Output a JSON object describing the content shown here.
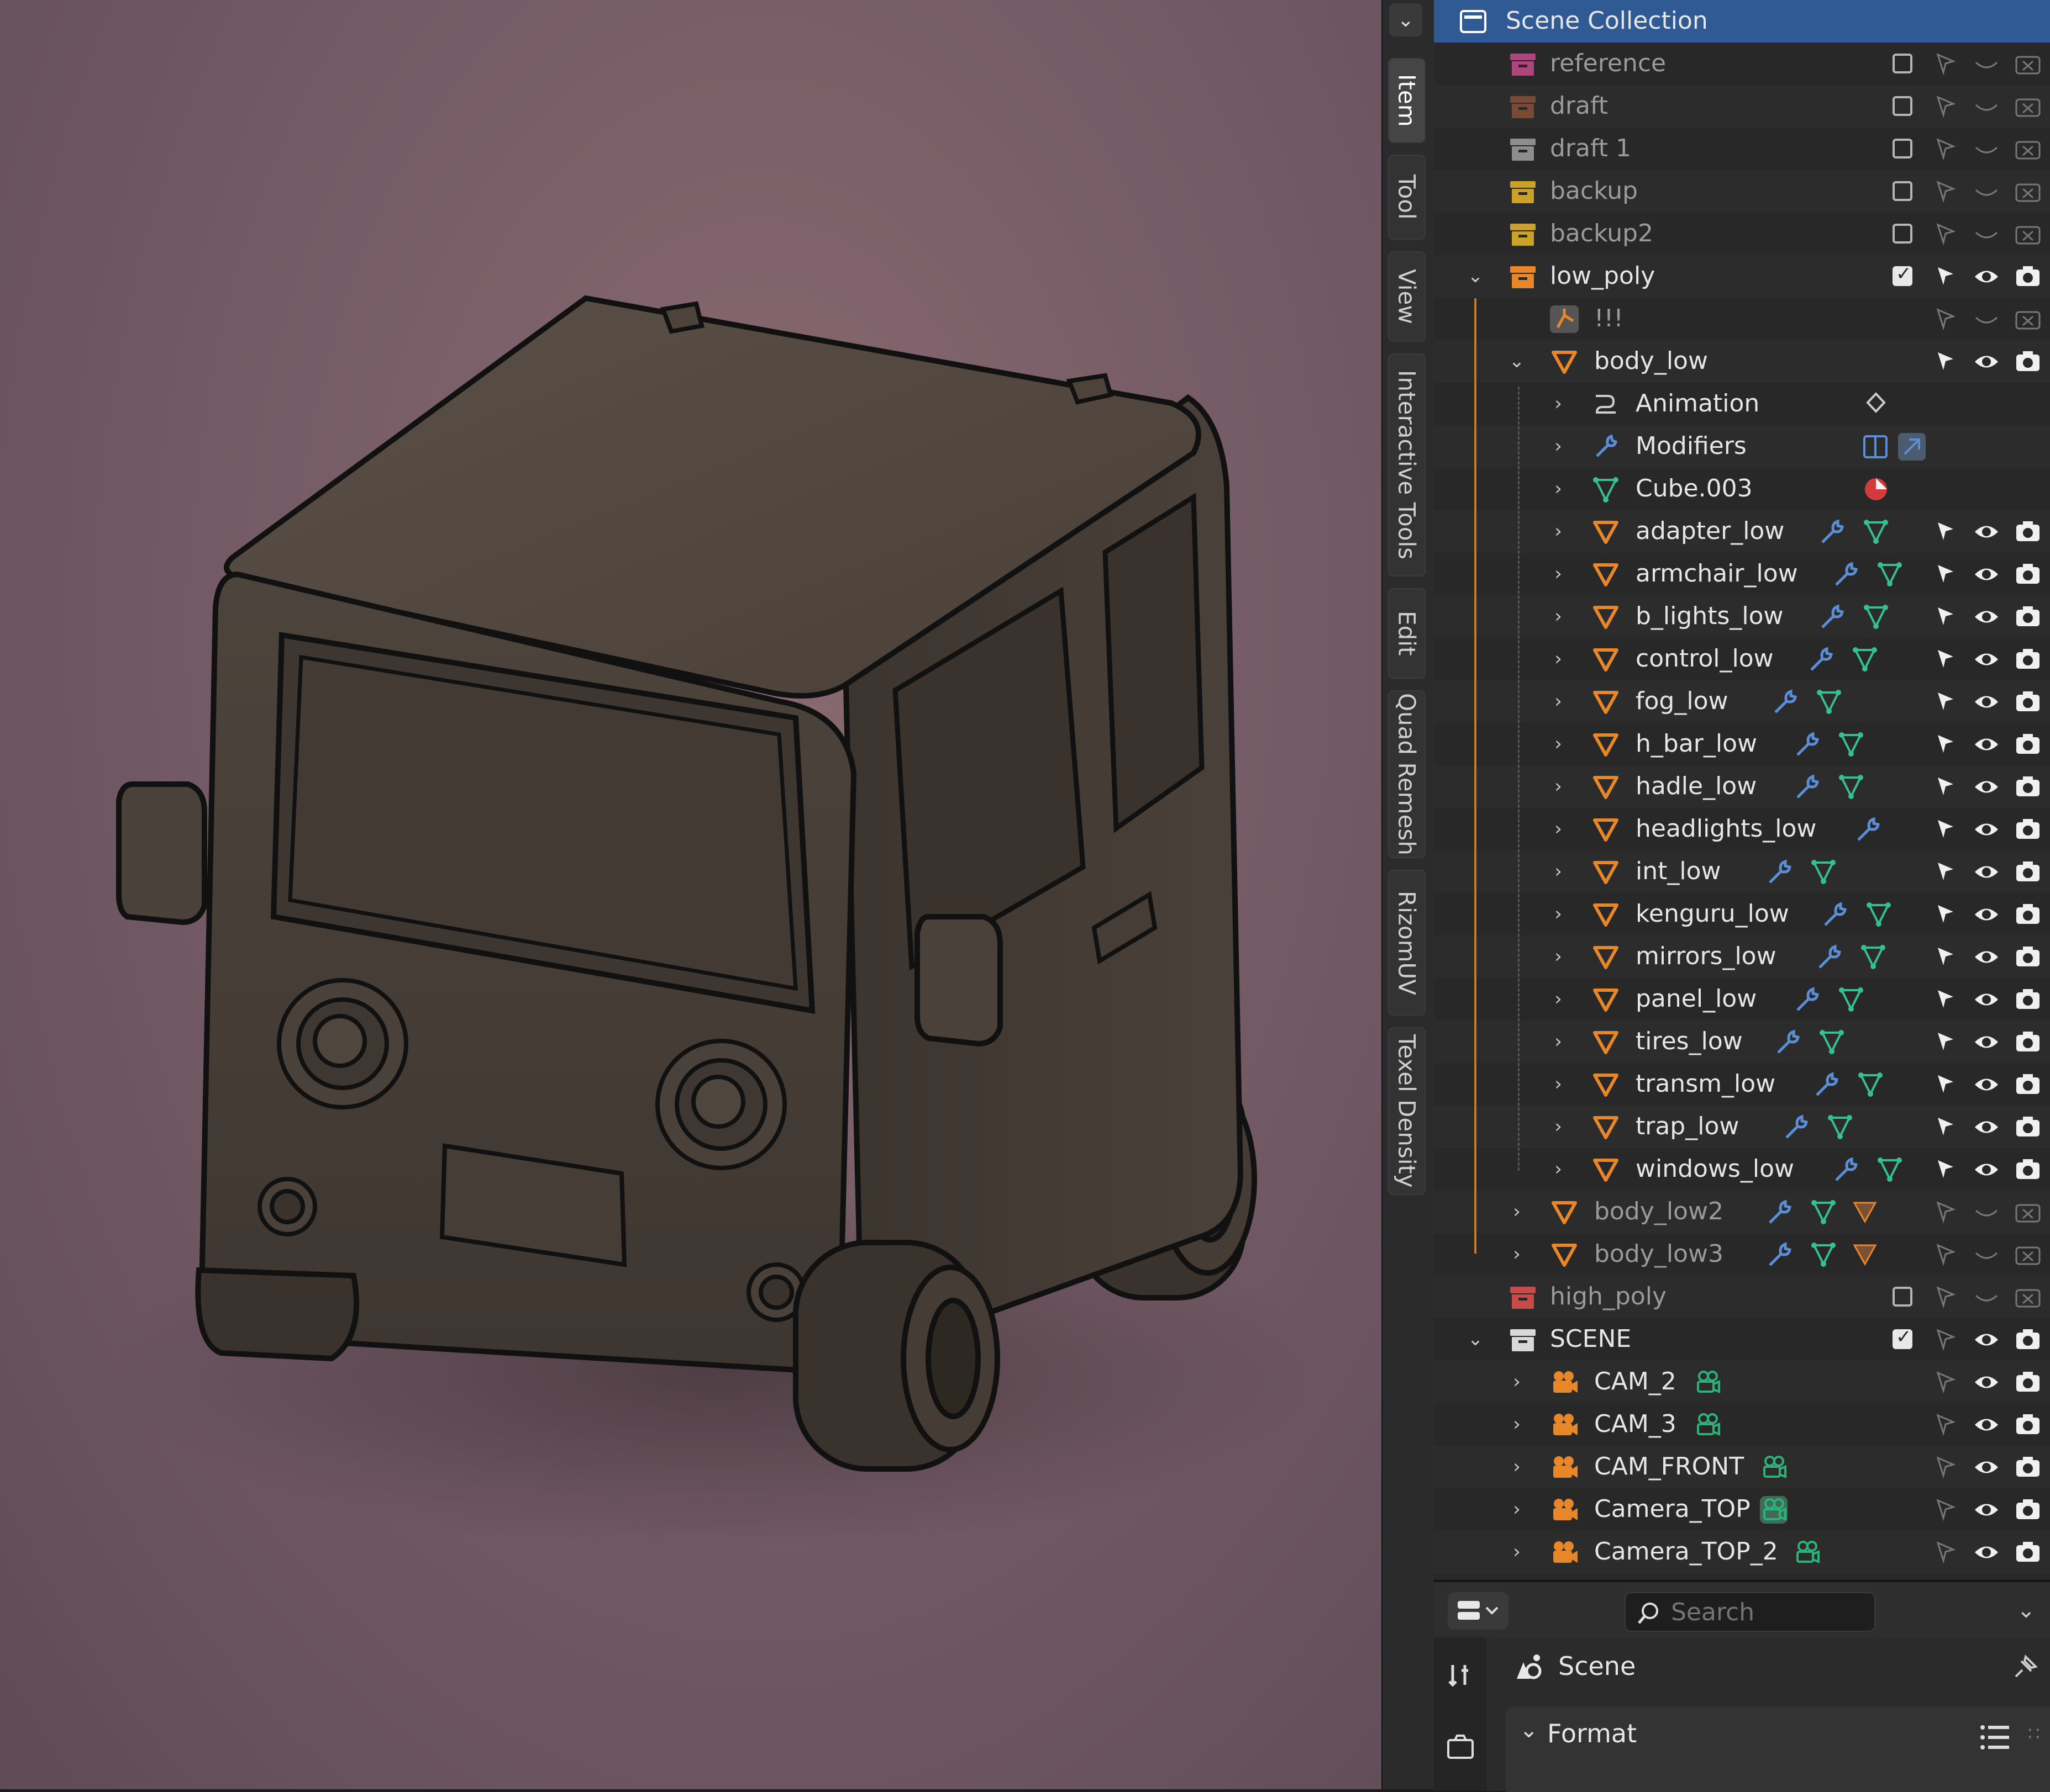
{
  "npanel": {
    "tabs": [
      "Item",
      "Tool",
      "View",
      "Interactive Tools",
      "Edit",
      "Quad Remesh",
      "RizomUV",
      "Texel Density"
    ]
  },
  "outliner": {
    "header": "Scene Collection",
    "rows": [
      {
        "label": "reference",
        "kind": "collection",
        "icon_color": "#b0457d",
        "dim": true
      },
      {
        "label": "draft",
        "kind": "collection",
        "icon_color": "#7a4a35",
        "dim": true
      },
      {
        "label": "draft 1",
        "kind": "collection",
        "icon_color": "#8d8d8d",
        "dim": true
      },
      {
        "label": "backup",
        "kind": "collection",
        "icon_color": "#c9a227",
        "dim": true
      },
      {
        "label": "backup2",
        "kind": "collection",
        "icon_color": "#c9a227",
        "dim": true
      },
      {
        "label": "low_poly",
        "kind": "collection",
        "icon_color": "#e8862a",
        "checked": true
      },
      {
        "label": "!!!",
        "kind": "empty",
        "dim": true
      },
      {
        "label": "body_low",
        "kind": "mesh"
      },
      {
        "label": "Animation",
        "kind": "animation"
      },
      {
        "label": "Modifiers",
        "kind": "modifiers"
      },
      {
        "label": "Cube.003",
        "kind": "meshdata"
      },
      {
        "label": "adapter_low",
        "kind": "mesh"
      },
      {
        "label": "armchair_low",
        "kind": "mesh"
      },
      {
        "label": "b_lights_low",
        "kind": "mesh"
      },
      {
        "label": "control_low",
        "kind": "mesh"
      },
      {
        "label": "fog_low",
        "kind": "mesh"
      },
      {
        "label": "h_bar_low",
        "kind": "mesh"
      },
      {
        "label": "hadle_low",
        "kind": "mesh"
      },
      {
        "label": "headlights_low",
        "kind": "mesh"
      },
      {
        "label": "int_low",
        "kind": "mesh"
      },
      {
        "label": "kenguru_low",
        "kind": "mesh"
      },
      {
        "label": "mirrors_low",
        "kind": "mesh"
      },
      {
        "label": "panel_low",
        "kind": "mesh"
      },
      {
        "label": "tires_low",
        "kind": "mesh"
      },
      {
        "label": "transm_low",
        "kind": "mesh"
      },
      {
        "label": "trap_low",
        "kind": "mesh"
      },
      {
        "label": "windows_low",
        "kind": "mesh"
      },
      {
        "label": "body_low2",
        "kind": "mesh",
        "dim": true,
        "badge": "1"
      },
      {
        "label": "body_low3",
        "kind": "mesh",
        "dim": true,
        "badge": "1"
      },
      {
        "label": "high_poly",
        "kind": "collection",
        "icon_color": "#c94a4a",
        "dim": true
      },
      {
        "label": "SCENE",
        "kind": "collection",
        "icon_color": "#d8d8d8",
        "checked": true
      },
      {
        "label": "CAM_2",
        "kind": "camera"
      },
      {
        "label": "CAM_3",
        "kind": "camera"
      },
      {
        "label": "CAM_FRONT",
        "kind": "camera"
      },
      {
        "label": "Camera_TOP",
        "kind": "camera"
      },
      {
        "label": "Camera_TOP_2",
        "kind": "camera"
      }
    ]
  },
  "properties": {
    "search_placeholder": "Search",
    "context_label": "Scene",
    "panel_label": "Format"
  },
  "colors": {
    "selection": "#2f5a93",
    "mesh_orange": "#e8862a",
    "modifier_blue": "#5a8fd8",
    "meshdata_green": "#35c090",
    "camera_green": "#2bb27a"
  }
}
